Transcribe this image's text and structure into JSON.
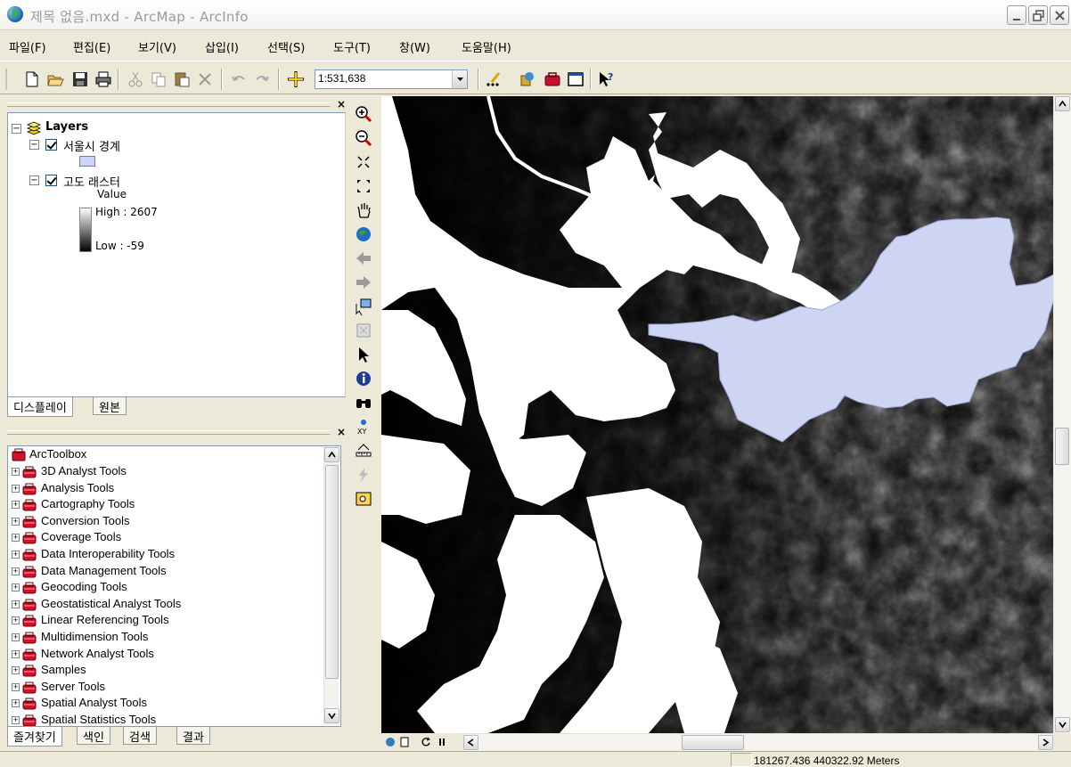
{
  "window": {
    "title": "제목 없음.mxd - ArcMap - ArcInfo"
  },
  "menu": [
    {
      "label": "파일(F)"
    },
    {
      "label": "편집(E)"
    },
    {
      "label": "보기(V)"
    },
    {
      "label": "삽입(I)"
    },
    {
      "label": "선택(S)"
    },
    {
      "label": "도구(T)"
    },
    {
      "label": "창(W)"
    },
    {
      "label": "도움말(H)"
    }
  ],
  "toolbar": {
    "scale_value": "1:531,638",
    "icons": [
      "new-document-icon",
      "open-folder-icon",
      "save-icon",
      "print-icon",
      "cut-icon",
      "copy-icon",
      "paste-icon",
      "delete-icon",
      "undo-icon",
      "redo-icon",
      "add-data-icon",
      "editor-icon",
      "arc-catalog-icon",
      "arc-toolbox-icon",
      "command-line-icon",
      "whats-this-icon"
    ]
  },
  "toc": {
    "root_label": "Layers",
    "layers": [
      {
        "name": "서울시 경계",
        "symbol_color": "#cdd5f3"
      },
      {
        "name": "고도 래스터",
        "legend_title": "Value",
        "high_label": "High : 2607",
        "low_label": "Low : -59"
      }
    ],
    "tabs": [
      "디스플레이",
      "원본"
    ]
  },
  "toolbox": {
    "root_label": "ArcToolbox",
    "items": [
      "3D Analyst Tools",
      "Analysis Tools",
      "Cartography Tools",
      "Conversion Tools",
      "Coverage Tools",
      "Data Interoperability Tools",
      "Data Management Tools",
      "Geocoding Tools",
      "Geostatistical Analyst Tools",
      "Linear Referencing Tools",
      "Multidimension Tools",
      "Network Analyst Tools",
      "Samples",
      "Server Tools",
      "Spatial Analyst Tools",
      "Spatial Statistics Tools"
    ],
    "tabs": [
      "즐겨찾기",
      "색인",
      "검색",
      "결과"
    ]
  },
  "tools": [
    "zoom-in-icon",
    "zoom-out-icon",
    "fixed-zoom-in-icon",
    "fixed-zoom-out-icon",
    "pan-icon",
    "full-extent-icon",
    "back-extent-icon",
    "forward-extent-icon",
    "select-features-icon",
    "clear-selection-icon",
    "select-elements-icon",
    "identify-icon",
    "find-icon",
    "go-to-xy-icon",
    "measure-icon",
    "hyperlink-icon",
    "html-popup-icon"
  ],
  "status": {
    "coordinates": "181267.436  440322.92 Meters"
  },
  "colors": {
    "seoul_fill": "#cdd5f3",
    "map_background": "#000000",
    "water": "#ffffff"
  }
}
